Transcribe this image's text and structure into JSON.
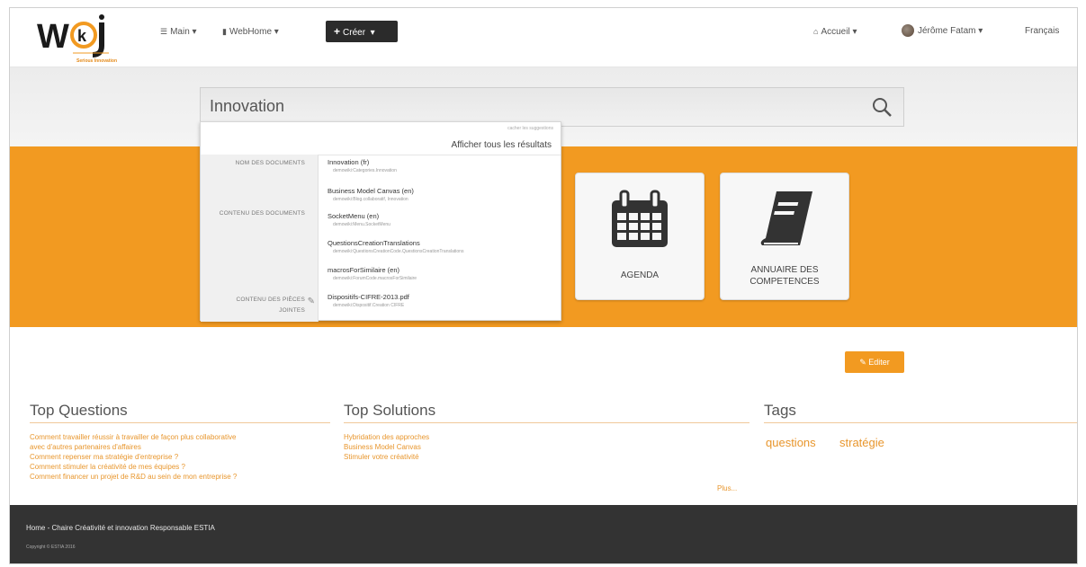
{
  "navbar": {
    "logo_subtext": "Serious Innovation",
    "main_label": "Main",
    "webhome_label": "WebHome",
    "create_label": "Créer",
    "accueil_label": "Accueil",
    "user_label": "Jérôme Fatam",
    "language_label": "Français"
  },
  "search": {
    "value": "Innovation"
  },
  "dropdown": {
    "cache_text": "cacher les suggestions",
    "show_all": "Afficher tous les résultats",
    "categories": [
      {
        "label": "NOM DES DOCUMENTS"
      },
      {
        "label": "CONTENU DES DOCUMENTS"
      },
      {
        "label": "CONTENU DES PIÈCES JOINTES"
      }
    ],
    "items": [
      {
        "title": "Innovation (fr)",
        "path": "demowiki:Categories.Innovation"
      },
      {
        "title": "Business Model Canvas (en)",
        "path": "demowiki:Blog.collaboratif, Innovation"
      },
      {
        "title": "SocketMenu (en)",
        "path": "demowiki:Menu.SocketMenu"
      },
      {
        "title": "QuestionsCreationTranslations",
        "path": "demowiki:QuestionsCreationCode.QuestionsCreationTranslations"
      },
      {
        "title": "macrosForSimilaire (en)",
        "path": "demowiki:ForumCode.macrosForSimilaire"
      },
      {
        "title": "Dispositifs-CIFRE-2013.pdf",
        "path": "demowiki:Dispositif.Creation CIFRE"
      }
    ]
  },
  "tiles": [
    {
      "label": "AGENDA",
      "icon": "calendar-icon"
    },
    {
      "label": "ANNUAIRE DES COMPETENCES",
      "icon": "book-icon"
    }
  ],
  "edit_label": "Editer",
  "top_questions": {
    "title": "Top Questions",
    "items": [
      "Comment travailler réussir à travailler de façon plus collaborative",
      "avec d'autres partenaires d'affaires",
      "Comment repenser ma stratégie d'entreprise ?",
      "Comment stimuler la créativité de mes équipes ?",
      "Comment financer un projet de R&D au sein de mon entreprise ?"
    ]
  },
  "top_solutions": {
    "title": "Top Solutions",
    "items": [
      "Hybridation des approches",
      "Business Model Canvas",
      "Stimuler votre créativité"
    ],
    "more_label": "Plus..."
  },
  "tags": {
    "title": "Tags",
    "items": [
      "questions",
      "stratégie"
    ]
  },
  "footer": {
    "breadcrumb": "Home - Chaire Créativité et innovation Responsable ESTIA",
    "copyright": "Copyright © ESTIA 2016"
  },
  "colors": {
    "accent": "#f29a21",
    "footer_bg": "#333333"
  }
}
